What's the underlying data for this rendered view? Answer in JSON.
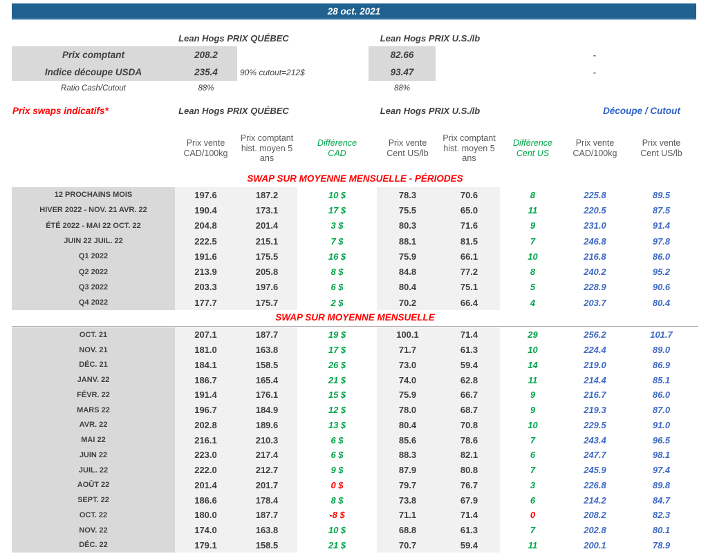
{
  "date_bar": {
    "date": "28 oct. 2021"
  },
  "colors": {
    "bar_blue": "#20618F",
    "accent_red": "#FF0000",
    "accent_green": "#00A44A",
    "accent_blue": "#3E6AC3",
    "label_bg": "#D9D9D9",
    "strip_bg": "#F1F1F1"
  },
  "top_summary": {
    "quebec_title": "Lean Hogs PRIX QUÉBEC",
    "us_title": "Lean Hogs PRIX U.S./lb",
    "rows": {
      "comptant": {
        "label": "Prix comptant",
        "qc": "208.2",
        "us": "82.66",
        "right": "-"
      },
      "indice": {
        "label": "Indice découpe USDA",
        "qc": "235.4",
        "note": "90% cutout=212$",
        "us": "93.47",
        "right": "-"
      },
      "ratio": {
        "label": "Ratio Cash/Cutout",
        "qc": "88%",
        "us": "88%"
      }
    }
  },
  "swaps_header": {
    "title": "Prix swaps indicatifs*",
    "quebec_title": "Lean Hogs PRIX QUÉBEC",
    "us_title": "Lean Hogs PRIX U.S./lb",
    "cutout_title": "Découpe / Cutout"
  },
  "columns": [
    "Prix vente\nCAD/100kg",
    "Prix comptant\nhist. moyen 5\nans",
    "Différence\nCAD",
    "Prix vente\nCent US/lb",
    "Prix comptant\nhist. moyen 5\nans",
    "Différence\nCent US",
    "Prix vente\nCAD/100kg",
    "Prix vente\nCent US/lb"
  ],
  "sections": [
    {
      "title": "SWAP SUR MOYENNE MENSUELLE - PÉRIODES",
      "rows": [
        [
          "12 PROCHAINS MOIS",
          "197.6",
          "187.2",
          "10 $",
          "78.3",
          "70.6",
          "8",
          "225.8",
          "89.5"
        ],
        [
          "HIVER 2022 - NOV. 21 AVR. 22",
          "190.4",
          "173.1",
          "17 $",
          "75.5",
          "65.0",
          "11",
          "220.5",
          "87.5"
        ],
        [
          "ÉTÉ 2022 - MAI 22 OCT. 22",
          "204.8",
          "201.4",
          "3 $",
          "80.3",
          "71.6",
          "9",
          "231.0",
          "91.4"
        ],
        [
          "JUIN 22 JUIL. 22",
          "222.5",
          "215.1",
          "7 $",
          "88.1",
          "81.5",
          "7",
          "246.8",
          "97.8"
        ],
        [
          "Q1 2022",
          "191.6",
          "175.5",
          "16 $",
          "75.9",
          "66.1",
          "10",
          "216.8",
          "86.0"
        ],
        [
          "Q2 2022",
          "213.9",
          "205.8",
          "8 $",
          "84.8",
          "77.2",
          "8",
          "240.2",
          "95.2"
        ],
        [
          "Q3 2022",
          "203.3",
          "197.6",
          "6 $",
          "80.4",
          "75.1",
          "5",
          "228.9",
          "90.6"
        ],
        [
          "Q4 2022",
          "177.7",
          "175.7",
          "2 $",
          "70.2",
          "66.4",
          "4",
          "203.7",
          "80.4"
        ]
      ]
    },
    {
      "title": "SWAP SUR MOYENNE MENSUELLE",
      "rows": [
        [
          "OCT. 21",
          "207.1",
          "187.7",
          "19 $",
          "100.1",
          "71.4",
          "29",
          "256.2",
          "101.7"
        ],
        [
          "NOV. 21",
          "181.0",
          "163.8",
          "17 $",
          "71.7",
          "61.3",
          "10",
          "224.4",
          "89.0"
        ],
        [
          "DÉC. 21",
          "184.1",
          "158.5",
          "26 $",
          "73.0",
          "59.4",
          "14",
          "219.0",
          "86.9"
        ],
        [
          "JANV. 22",
          "186.7",
          "165.4",
          "21 $",
          "74.0",
          "62.8",
          "11",
          "214.4",
          "85.1"
        ],
        [
          "FÉVR. 22",
          "191.4",
          "176.1",
          "15 $",
          "75.9",
          "66.7",
          "9",
          "216.7",
          "86.0"
        ],
        [
          "MARS 22",
          "196.7",
          "184.9",
          "12 $",
          "78.0",
          "68.7",
          "9",
          "219.3",
          "87.0"
        ],
        [
          "AVR. 22",
          "202.8",
          "189.6",
          "13 $",
          "80.4",
          "70.8",
          "10",
          "229.5",
          "91.0"
        ],
        [
          "MAI 22",
          "216.1",
          "210.3",
          "6 $",
          "85.6",
          "78.6",
          "7",
          "243.4",
          "96.5"
        ],
        [
          "JUIN 22",
          "223.0",
          "217.4",
          "6 $",
          "88.3",
          "82.1",
          "6",
          "247.7",
          "98.1"
        ],
        [
          "JUIL. 22",
          "222.0",
          "212.7",
          "9 $",
          "87.9",
          "80.8",
          "7",
          "245.9",
          "97.4"
        ],
        [
          "AOÛT 22",
          "201.4",
          "201.7",
          "0 $",
          "79.7",
          "76.7",
          "3",
          "226.8",
          "89.8"
        ],
        [
          "SEPT. 22",
          "186.6",
          "178.4",
          "8 $",
          "73.8",
          "67.9",
          "6",
          "214.2",
          "84.7"
        ],
        [
          "OCT. 22",
          "180.0",
          "187.7",
          "-8 $",
          "71.1",
          "71.4",
          "0",
          "208.2",
          "82.3"
        ],
        [
          "NOV. 22",
          "174.0",
          "163.8",
          "10 $",
          "68.8",
          "61.3",
          "7",
          "202.8",
          "80.1"
        ],
        [
          "DÉC. 22",
          "179.1",
          "158.5",
          "21 $",
          "70.7",
          "59.4",
          "11",
          "200.1",
          "78.9"
        ]
      ]
    }
  ]
}
